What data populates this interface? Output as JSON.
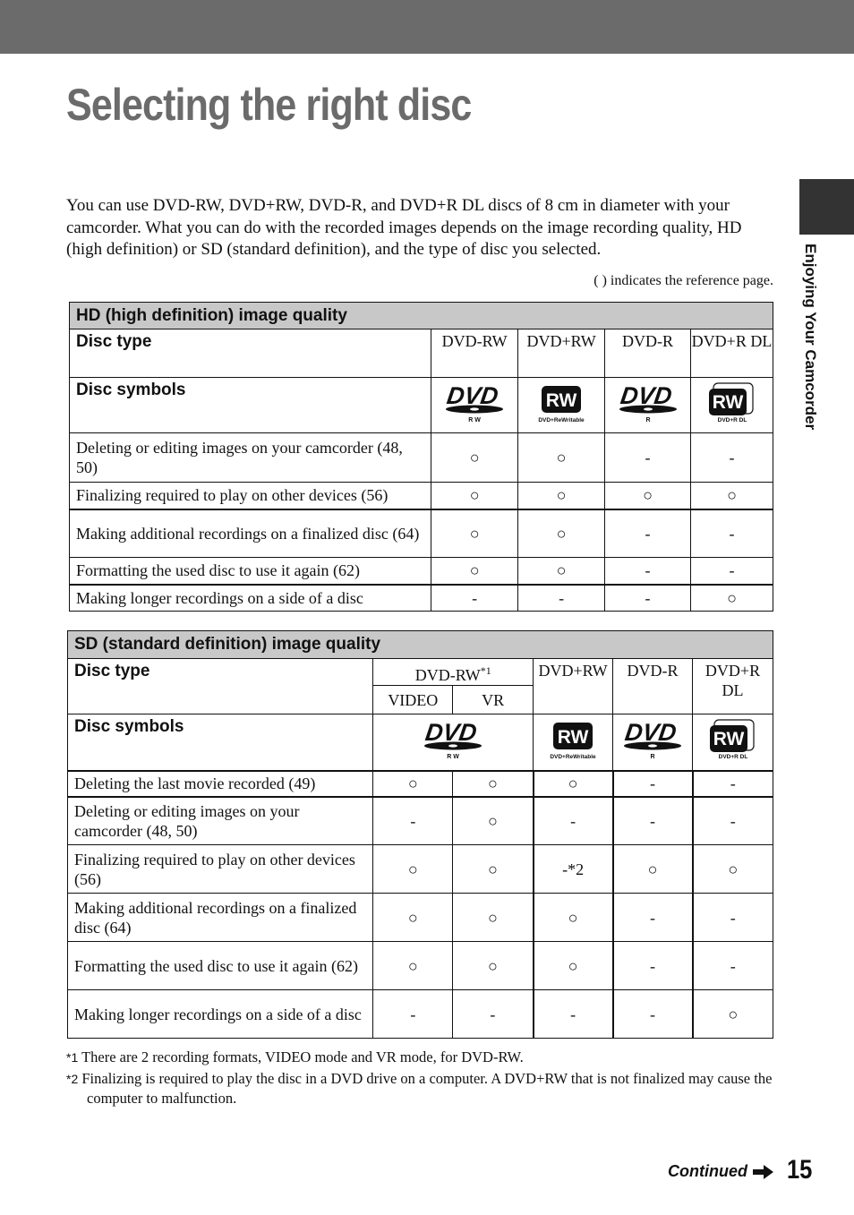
{
  "title": "Selecting the right disc",
  "intro": "You can use DVD-RW, DVD+RW, DVD-R, and DVD+R DL discs of 8 cm in diameter with your camcorder. What you can do with the recorded images depends on the image recording quality, HD (high definition) or SD (standard definition), and the type of disc you selected.",
  "ref_note": "( ) indicates the reference page.",
  "side_tab": "Enjoying Your Camcorder",
  "hd_table": {
    "header": "HD (high definition) image quality",
    "disc_type_label": "Disc type",
    "disc_symbols_label": "Disc symbols",
    "columns": [
      "DVD-RW",
      "DVD+RW",
      "DVD-R",
      "DVD+R DL"
    ],
    "symbols": [
      {
        "type": "dvd",
        "sub": "R W"
      },
      {
        "type": "rw",
        "sub": "DVD+ReWritable"
      },
      {
        "type": "dvd",
        "sub": "R"
      },
      {
        "type": "rwdl",
        "sub": "DVD+R DL"
      }
    ],
    "rows": [
      {
        "label": "Deleting or editing images on your camcorder (48, 50)",
        "values": [
          "○",
          "○",
          "-",
          "-"
        ]
      },
      {
        "label": "Finalizing required to play on other devices (56)",
        "values": [
          "○",
          "○",
          "○",
          "○"
        ]
      },
      {
        "label": "Making additional recordings on a finalized disc (64)",
        "values": [
          "○",
          "○",
          "-",
          "-"
        ]
      },
      {
        "label": "Formatting the used disc to use it again (62)",
        "values": [
          "○",
          "○",
          "-",
          "-"
        ]
      },
      {
        "label": "Making longer recordings on a side of a disc",
        "values": [
          "-",
          "-",
          "-",
          "○"
        ]
      }
    ]
  },
  "sd_table": {
    "header": "SD (standard definition) image quality",
    "disc_type_label": "Disc type",
    "disc_symbols_label": "Disc symbols",
    "dvdrw": "DVD-RW",
    "dvdrw_note": "*1",
    "sub_columns": [
      "VIDEO",
      "VR"
    ],
    "columns": [
      "DVD+RW",
      "DVD-R",
      "DVD+R DL"
    ],
    "symbols": [
      {
        "type": "dvd",
        "sub": "R W"
      },
      {
        "type": "rw",
        "sub": "DVD+ReWritable"
      },
      {
        "type": "dvd",
        "sub": "R"
      },
      {
        "type": "rwdl",
        "sub": "DVD+R DL"
      }
    ],
    "rows": [
      {
        "label": "Deleting the last movie recorded (49)",
        "values": [
          "○",
          "○",
          "○",
          "-",
          "-"
        ]
      },
      {
        "label": "Deleting or editing images on your camcorder (48, 50)",
        "values": [
          "-",
          "○",
          "-",
          "-",
          "-"
        ]
      },
      {
        "label": "Finalizing required to play on other devices (56)",
        "values": [
          "○",
          "○",
          "-*2",
          "○",
          "○"
        ]
      },
      {
        "label": "Making additional recordings on a finalized disc (64)",
        "values": [
          "○",
          "○",
          "○",
          "-",
          "-"
        ]
      },
      {
        "label": "Formatting the used disc to use it again (62)",
        "values": [
          "○",
          "○",
          "○",
          "-",
          "-"
        ]
      },
      {
        "label": "Making longer recordings on a side of a disc",
        "values": [
          "-",
          "-",
          "-",
          "-",
          "○"
        ]
      }
    ]
  },
  "footnotes": [
    {
      "mark": "*1",
      "text": "There are 2 recording formats, VIDEO mode and VR mode, for DVD-RW."
    },
    {
      "mark": "*2",
      "text": "Finalizing is required to play the disc in a DVD drive on a computer. A DVD+RW that is not finalized may cause the computer to malfunction."
    }
  ],
  "continued": "Continued",
  "page_number": "15"
}
